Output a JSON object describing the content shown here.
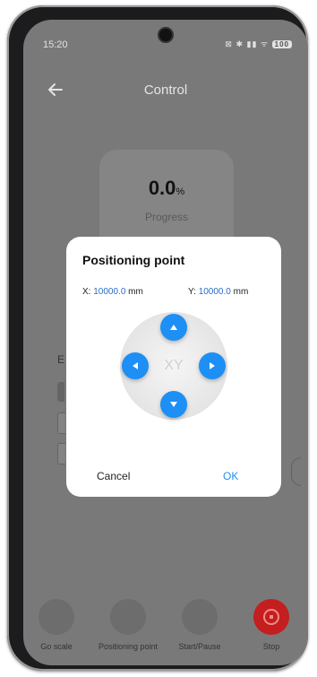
{
  "status_bar": {
    "time": "15:20",
    "icons_text": "⊠ ✱ ▮▮ ᯤ",
    "battery": "100"
  },
  "nav": {
    "title": "Control"
  },
  "progress": {
    "value": "0.0",
    "unit": "%",
    "label": "Progress"
  },
  "background": {
    "label": "E"
  },
  "dialog": {
    "title": "Positioning point",
    "x_label": "X:",
    "x_value": "10000.0",
    "x_unit": "mm",
    "y_label": "Y:",
    "y_value": "10000.0",
    "y_unit": "mm",
    "center_label": "XY",
    "cancel": "Cancel",
    "ok": "OK"
  },
  "bottom_bar": {
    "items": [
      {
        "label": "Go scale"
      },
      {
        "label": "Positioning point"
      },
      {
        "label": "Start/Pause"
      },
      {
        "label": "Stop"
      }
    ]
  },
  "colors": {
    "accent": "#1d8ff5",
    "stop": "#c41e1e"
  }
}
